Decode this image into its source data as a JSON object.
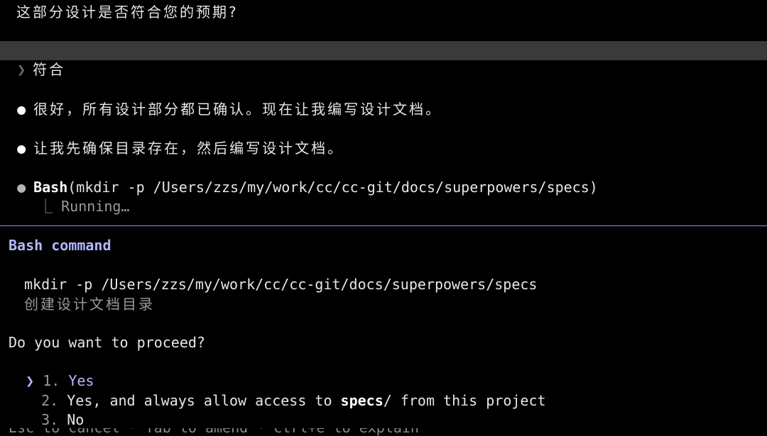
{
  "colors": {
    "background": "#000000",
    "text": "#e6e6e6",
    "selected_bar": "#3a3a3a",
    "accent": "#b4b7ff",
    "divider": "#8b8de0"
  },
  "question": "这部分设计是否符合您的预期?",
  "selected_answer": {
    "chevron": "❯",
    "text": "符合"
  },
  "messages": [
    {
      "bullet": "●",
      "text": "很好，所有设计部分都已确认。现在让我编写设计文档。"
    },
    {
      "bullet": "●",
      "text": "让我先确保目录存在，然后编写设计文档。"
    }
  ],
  "tool_call": {
    "bullet": "●",
    "tool_name": "Bash",
    "args": "(mkdir -p /Users/zzs/my/work/cc/cc-git/docs/superpowers/specs)",
    "status_prefix": "⎿",
    "status": "Running…"
  },
  "prompt_panel": {
    "title": "Bash command",
    "command": "mkdir -p /Users/zzs/my/work/cc/cc-git/docs/superpowers/specs",
    "description": "创建设计文档目录",
    "question": "Do you want to proceed?",
    "cursor": "❯",
    "options": [
      {
        "number": "1.",
        "label": "Yes"
      },
      {
        "number": "2.",
        "label_before": "Yes, and always allow access to ",
        "label_bold": "specs",
        "label_after": "/ from this project"
      },
      {
        "number": "3.",
        "label": "No"
      }
    ],
    "footer_hint": "Esc to cancel · Tab to amend · ctrl+e to explain"
  }
}
